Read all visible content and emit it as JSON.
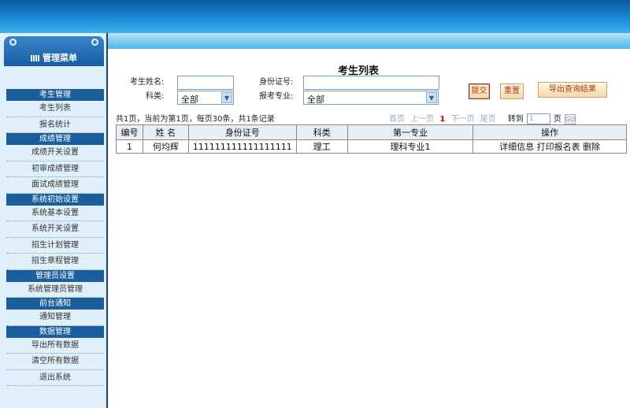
{
  "sidebar": {
    "title": "管理菜单",
    "sections": [
      {
        "label": "考生管理",
        "items": [
          "考生列表",
          "报名统计"
        ]
      },
      {
        "label": "成绩管理",
        "items": [
          "成绩开关设置",
          "初审成绩管理",
          "面试成绩管理"
        ]
      },
      {
        "label": "系统初始设置",
        "items": [
          "系统基本设置",
          "系统开关设置",
          "招生计划管理",
          "招生章程管理"
        ]
      },
      {
        "label": "管理员设置",
        "items": [
          "系统管理员管理"
        ]
      },
      {
        "label": "前台通知",
        "items": [
          "通知管理"
        ]
      },
      {
        "label": "数据管理",
        "items": [
          "导出所有数据",
          "清空所有数据",
          "退出系统"
        ]
      }
    ]
  },
  "page": {
    "title": "考生列表"
  },
  "form": {
    "name_label": "考生姓名:",
    "name_value": "",
    "id_label": "身份证号:",
    "id_value": "",
    "category_label": "科类:",
    "category_value": "全部",
    "major_label": "报考专业:",
    "major_value": "全部",
    "submit_label": "提交",
    "reset_label": "重置",
    "export_label": "导出查询结果"
  },
  "summary": "共1页，当前为第1页，每页30条，共1条记录",
  "pager": {
    "first": "首页",
    "prev": "上一页",
    "current": "1",
    "next": "下一页",
    "last": "尾页",
    "goto_label": "转到",
    "goto_value": "1",
    "page_unit": "页",
    "go": "GO"
  },
  "table": {
    "headers": [
      "编号",
      "姓  名",
      "身份证号",
      "科类",
      "第一专业",
      "操作"
    ],
    "rows": [
      {
        "no": "1",
        "name": "何均辉",
        "id": "111111111111111111",
        "category": "理工",
        "major": "理科专业1",
        "ops": "详细信息 打印报名表 删除"
      }
    ]
  }
}
